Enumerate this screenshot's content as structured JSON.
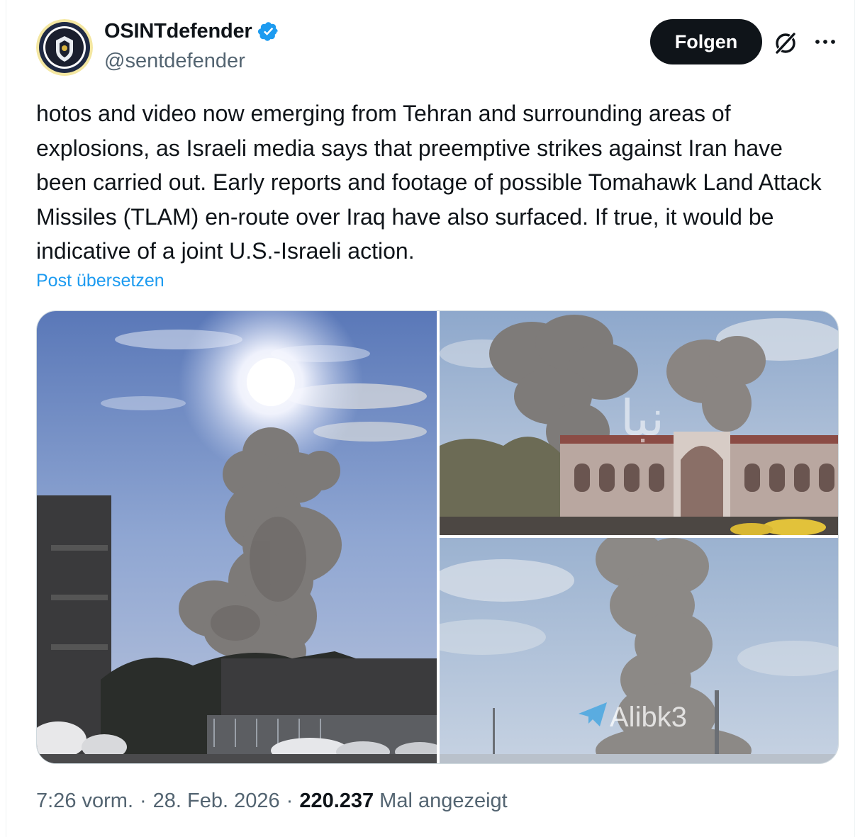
{
  "author": {
    "display_name": "OSINTdefender",
    "handle": "@sentdefender",
    "verified": true,
    "verified_icon": "verified-badge-icon",
    "accent_color": "#1d9bf0"
  },
  "actions": {
    "follow_label": "Folgen",
    "grok_icon": "grok-icon",
    "more_icon": "more-options-icon"
  },
  "post": {
    "text": "hotos and video now emerging from Tehran and surrounding areas of explosions, as Israeli media says that preemptive strikes against Iran have been carried out. Early reports and footage of possible Tomahawk Land Attack Missiles (TLAM) en-route over Iraq have also surfaced. If true, it would be indicative of a joint U.S.-Israeli action.",
    "translate_label": "Post übersetzen"
  },
  "media": {
    "count": 3,
    "photos": [
      {
        "name": "photo-smoke-plume-sun",
        "watermark": ""
      },
      {
        "name": "photo-smoke-over-building",
        "watermark": "نبا"
      },
      {
        "name": "photo-smoke-column-sky",
        "watermark": "Alibk3"
      }
    ]
  },
  "meta": {
    "time": "7:26 vorm.",
    "separator": "·",
    "date": "28. Feb. 2026",
    "views_count": "220.237",
    "views_label": "Mal angezeigt"
  }
}
